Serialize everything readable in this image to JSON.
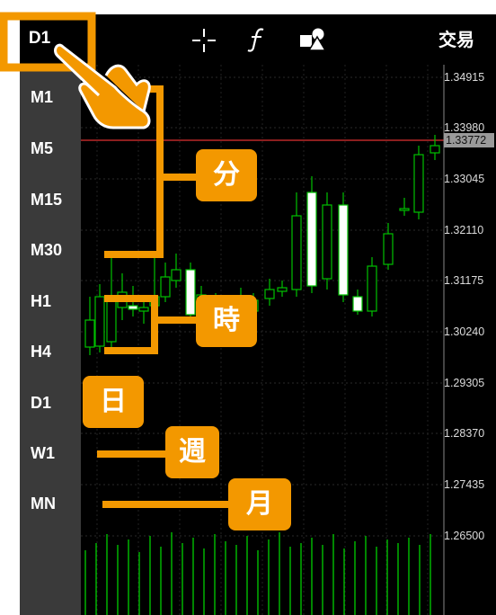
{
  "toolbar": {
    "current_timeframe": "D1",
    "crosshair_icon": "crosshair-icon",
    "indicator_icon": "function-icon",
    "objects_icon": "shapes-icon",
    "trade_label": "交易"
  },
  "timeframes": [
    "M1",
    "M5",
    "M15",
    "M30",
    "H1",
    "H4",
    "D1",
    "W1",
    "MN"
  ],
  "price_axis": {
    "ticks": [
      "1.34915",
      "1.33980",
      "1.33045",
      "1.32110",
      "1.31175",
      "1.30240",
      "1.29305",
      "1.28370",
      "1.27435",
      "1.26500"
    ],
    "current_price": "1.33772"
  },
  "annotations": {
    "minute": "分",
    "hour": "時",
    "day": "日",
    "week": "週",
    "month": "月"
  },
  "colors": {
    "annotation": "#f39800",
    "candle_bull": "#00c000",
    "candle_bear_body": "#ffffff",
    "current_price_line": "#e03030",
    "sidebar": "#3a3a3a",
    "chart_bg": "#000000"
  }
}
